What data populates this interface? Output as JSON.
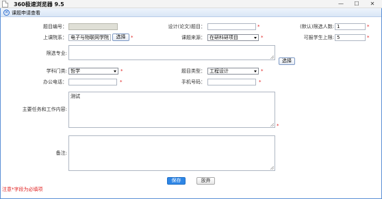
{
  "window": {
    "title": "360极速浏览器 9.5",
    "min_symbol": "—",
    "max_symbol": "☐",
    "close_symbol": "✕"
  },
  "header": {
    "close_symbol": "✕",
    "title": "课题申请查看"
  },
  "form": {
    "topic_no_label": "题目编号：",
    "topic_no_value": "",
    "design_title_label": "设计(论文)题目：",
    "design_title_value": "",
    "max_students_label": "(默认)限选人数:",
    "max_students_value": "1",
    "dept_label": "上课院系：",
    "dept_value": "电子与物联网学院",
    "dept_select_button": "选择",
    "source_label": "课题来源：",
    "source_value": "在研科研项目",
    "student_limit_label": "可报学生上限:",
    "student_limit_value": "5",
    "major_label": "限选专业:",
    "major_value": "",
    "major_select_button": "选择",
    "discipline_label": "学科门类:",
    "discipline_value": "哲学",
    "topic_type_label": "题目类型：",
    "topic_type_value": "工程设计",
    "office_phone_label": "办公电话：",
    "office_phone_value": "",
    "mobile_label": "手机号码：",
    "mobile_value": "",
    "tasks_label": "主要任务和工作内容:",
    "tasks_value": "测试",
    "remarks_label": "备注:",
    "remarks_value": "",
    "required_mark": "*"
  },
  "actions": {
    "save_label": "保存",
    "cancel_label": "放弃"
  },
  "footnote": "注意*字段为必填项",
  "colors": {
    "accent": "#2e86e6",
    "required": "#e02020",
    "window_border": "#5b8fd6"
  }
}
